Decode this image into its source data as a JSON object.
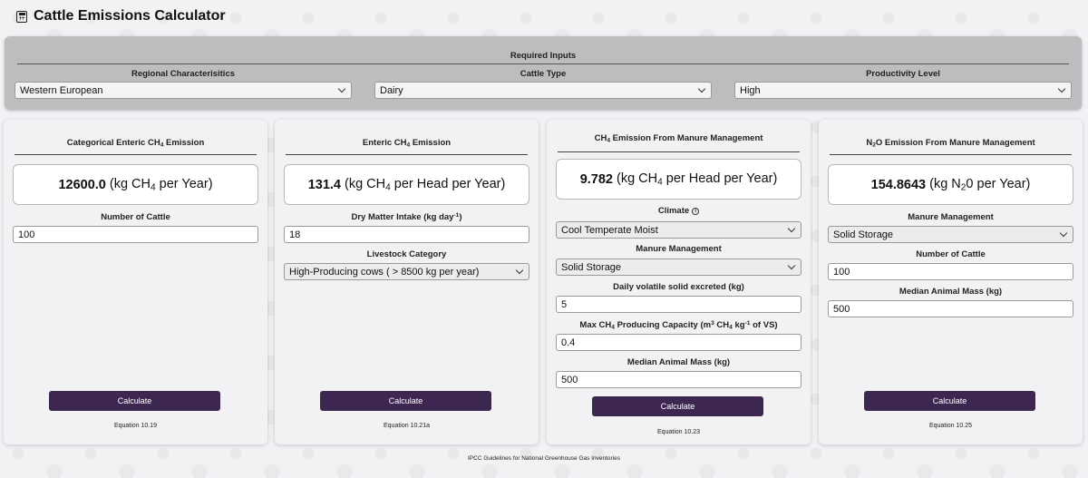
{
  "app": {
    "title": "Cattle Emissions Calculator",
    "icon": "calculator-icon"
  },
  "required_inputs": {
    "title": "Required Inputs",
    "regional": {
      "label": "Regional Characterisitics",
      "value": "Western European"
    },
    "cattle_type": {
      "label": "Cattle Type",
      "value": "Dairy"
    },
    "productivity": {
      "label": "Productivity Level",
      "value": "High"
    }
  },
  "cards": {
    "categorical": {
      "title_pre": "Categorical Enteric CH",
      "title_sub": "4",
      "title_post": " Emission",
      "result_value": "12600.0",
      "result_unit_pre": "(kg CH",
      "result_unit_sub": "4",
      "result_unit_post": " per Year)",
      "cattle_label": "Number of Cattle",
      "cattle_value": "100",
      "button": "Calculate",
      "equation": "Equation 10.19"
    },
    "enteric": {
      "title_pre": "Enteric CH",
      "title_sub": "4",
      "title_post": " Emission",
      "result_value": "131.4",
      "result_unit_pre": "(kg CH",
      "result_unit_sub": "4",
      "result_unit_post": " per Head per Year)",
      "dmi_label_pre": "Dry Matter Intake (kg day",
      "dmi_label_sup": "-1",
      "dmi_label_post": ")",
      "dmi_value": "18",
      "livestock_label": "Livestock Category",
      "livestock_value": "High-Producing cows ( > 8500 kg per year)",
      "button": "Calculate",
      "equation": "Equation 10.21a"
    },
    "manure_ch4": {
      "title_pre": "CH",
      "title_sub": "4",
      "title_post": " Emission From Manure Management",
      "result_value": "9.782",
      "result_unit_pre": "(kg CH",
      "result_unit_sub": "4",
      "result_unit_post": " per Head per Year)",
      "climate_label": "Climate",
      "climate_value": "Cool Temperate Moist",
      "manure_label": "Manure Management",
      "manure_value": "Solid Storage",
      "vs_label": "Daily volatile solid excreted (kg)",
      "vs_value": "5",
      "max_label_pre": "Max CH",
      "max_label_sub": "4",
      "max_label_mid": " Producing Capacity (m",
      "max_label_sup": "3",
      "max_label_mid2": " CH",
      "max_label_sub2": "4",
      "max_label_mid3": " kg",
      "max_label_sup2": "-1",
      "max_label_post": " of VS)",
      "max_value": "0.4",
      "mass_label": "Median Animal Mass (kg)",
      "mass_value": "500",
      "button": "Calculate",
      "equation": "Equation 10.23"
    },
    "manure_n2o": {
      "title_pre": "N",
      "title_sub": "2",
      "title_post": "O Emission From Manure Management",
      "result_value": "154.8643",
      "result_unit_pre": "(kg N",
      "result_unit_sub": "2",
      "result_unit_post": "0 per Year)",
      "manure_label": "Manure Management",
      "manure_value": "Solid Storage",
      "cattle_label": "Number of Cattle",
      "cattle_value": "100",
      "mass_label": "Median Animal Mass (kg)",
      "mass_value": "500",
      "button": "Calculate",
      "equation": "Equation 10.25"
    }
  },
  "footer": "IPCC Guidelines for National Greenhouse Gas Inventories"
}
